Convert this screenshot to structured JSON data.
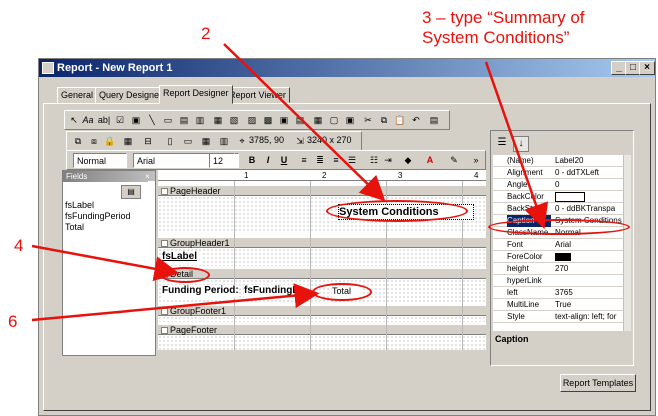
{
  "window": {
    "title": "Report - New Report 1"
  },
  "tabs": [
    "General",
    "Query Designer",
    "Report Designer",
    "Report Viewer"
  ],
  "toolbar": {
    "coords": "3785, 90",
    "size": "3240 x 270",
    "style_select": "Normal",
    "font_select": "Arial",
    "size_select": "12",
    "bold": "B",
    "italic": "I",
    "underline": "U"
  },
  "field_list": {
    "title": "Fields",
    "items": [
      "fsLabel",
      "fsFundingPeriod",
      "Total"
    ]
  },
  "ruler": {
    "marks": [
      "1",
      "2",
      "3",
      "4"
    ]
  },
  "sections": {
    "page_header": "PageHeader",
    "group_header": "GroupHeader1",
    "detail": "Detail",
    "group_footer": "GroupFooter1",
    "page_footer": "PageFooter"
  },
  "design": {
    "caption_label": "System Conditions",
    "fs_label": "fsLabel",
    "funding_period_label": "Funding Period:",
    "fs_funding_field": "fsFundingPe",
    "total_field": "Total"
  },
  "properties": {
    "rows": [
      {
        "name": "(Name)",
        "value": "Label20"
      },
      {
        "name": "Alignment",
        "value": "0 - ddTXLeft"
      },
      {
        "name": "Angle",
        "value": "0"
      },
      {
        "name": "BackColor",
        "value": ""
      },
      {
        "name": "BackStyle",
        "value": "0 - ddBKTranspa"
      },
      {
        "name": "Caption",
        "value": "System Conditions"
      },
      {
        "name": "ClassName",
        "value": "Normal"
      },
      {
        "name": "Font",
        "value": "Arial"
      },
      {
        "name": "ForeColor",
        "value": ""
      },
      {
        "name": "height",
        "value": "270"
      },
      {
        "name": "hyperLink",
        "value": ""
      },
      {
        "name": "left",
        "value": "3765"
      },
      {
        "name": "MultiLine",
        "value": "True"
      },
      {
        "name": "Style",
        "value": "text-align: left; for"
      }
    ],
    "description_title": "Caption"
  },
  "report_templates_button": "Report Templates",
  "annotations": {
    "step2": "2",
    "step3_line1": "3 – type “Summary of",
    "step3_line2": "System Conditions”",
    "step4": "4",
    "step6": "6"
  },
  "colors": {
    "callout": "#e8120c",
    "titlebar": "#0a246a",
    "chrome": "#d4d0c8"
  }
}
